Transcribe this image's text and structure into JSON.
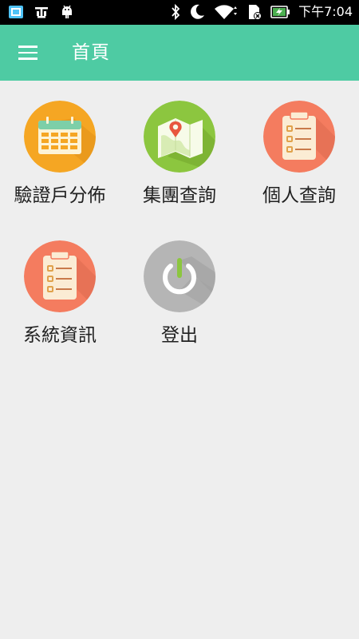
{
  "status_bar": {
    "time": "下午7:04",
    "icons": [
      "screenshot-icon",
      "usb-debug-icon",
      "android-icon",
      "bluetooth-icon",
      "moon-icon",
      "wifi-icon",
      "sd-card-icon",
      "battery-charging-icon"
    ]
  },
  "app_bar": {
    "title": "首頁",
    "menu_icon": "hamburger-menu-icon",
    "color": "#4ecba3"
  },
  "menu": {
    "items": [
      {
        "label": "驗證戶分佈",
        "icon": "calendar-icon",
        "color": "#f5a623"
      },
      {
        "label": "集團查詢",
        "icon": "map-pin-icon",
        "color": "#8cc63f"
      },
      {
        "label": "個人查詢",
        "icon": "clipboard-list-icon",
        "color": "#f47c5f"
      },
      {
        "label": "系統資訊",
        "icon": "clipboard-list-icon",
        "color": "#f47c5f"
      },
      {
        "label": "登出",
        "icon": "power-icon",
        "color": "#b5b5b5"
      }
    ]
  }
}
